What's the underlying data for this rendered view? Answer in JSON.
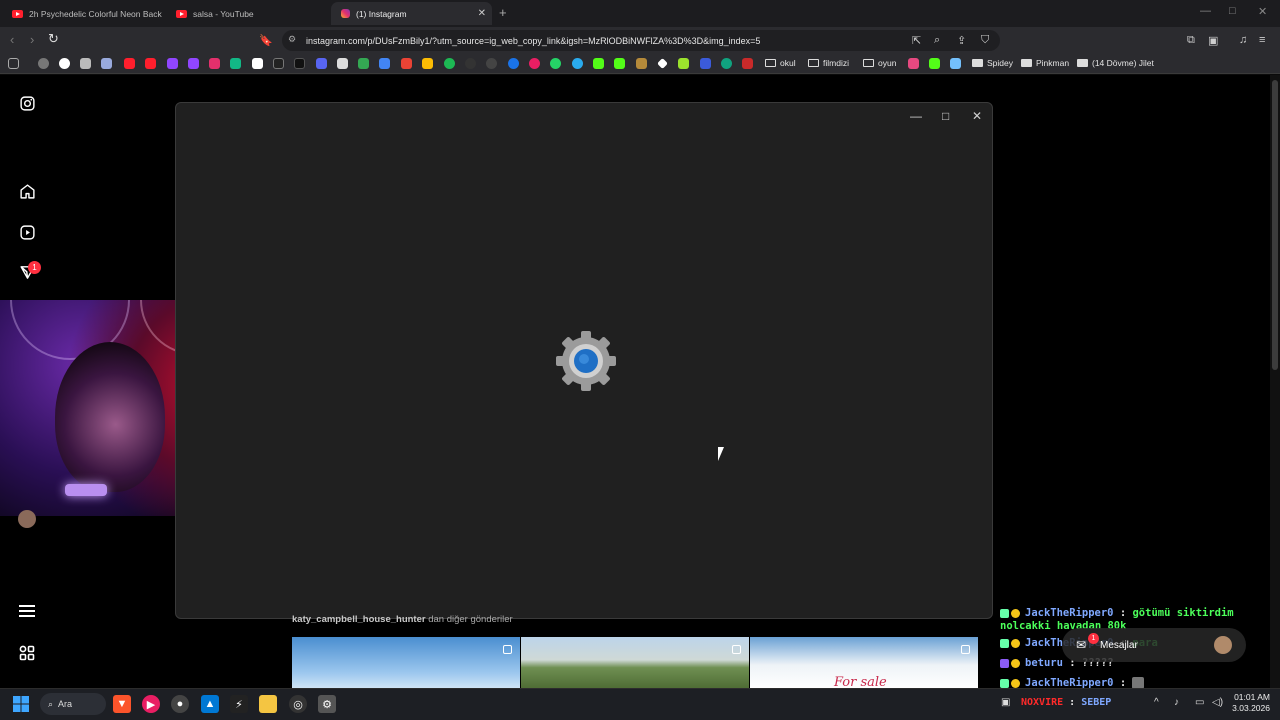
{
  "browser": {
    "tabs": [
      {
        "label": "2h Psychedelic Colorful Neon Backgro",
        "icon": "youtube-icon"
      },
      {
        "label": "salsa - YouTube",
        "icon": "youtube-icon"
      },
      {
        "label": "(1) Instagram",
        "icon": "instagram-icon",
        "active": true
      }
    ],
    "url": "instagram.com/p/DUsFzmBily1/?utm_source=ig_web_copy_link&igsh=MzRlODBiNWFlZA%3D%3D&img_index=5",
    "bookmark_folders": [
      "okul",
      "filmdizi",
      "oyun"
    ],
    "bookmark_pages": [
      "Spidey",
      "Pinkman",
      "(14 Dövme) Jilet"
    ]
  },
  "instagram": {
    "notification_count": "1",
    "post_owner": "katy_campbell_house_hunter",
    "post_owner_suffix": "dan diğer gönderiler",
    "thumb3_text": "For sale",
    "messages_label": "Mesajlar",
    "messages_badge": "1"
  },
  "chat": [
    {
      "user": "JackTheRipper0",
      "message": "götümü siktirdim",
      "color": "#7fa8ff",
      "msg_color": "#4cff5a"
    },
    {
      "user": "",
      "message": "nolcakki havadan 80k",
      "color": "#4cff5a",
      "msg_color": "#4cff5a"
    },
    {
      "user": "JackTheRipper0",
      "message": "para",
      "color": "#7fa8ff",
      "msg_color": "#4cff5a"
    },
    {
      "user": "beturu",
      "message": "?????",
      "color": "#7fa8ff",
      "msg_color": "#e6e6e6"
    },
    {
      "user": "JackTheRipper0",
      "message": "",
      "color": "#7fa8ff",
      "msg_color": "#e6e6e6"
    },
    {
      "user": "NOXVIRE",
      "message": "SEBEP",
      "color": "#ff2a2a",
      "msg_color": "#7fa8ff"
    }
  ],
  "taskbar": {
    "search_label": "Ara",
    "time": "01:01 AM",
    "date": "3.03.2026"
  }
}
